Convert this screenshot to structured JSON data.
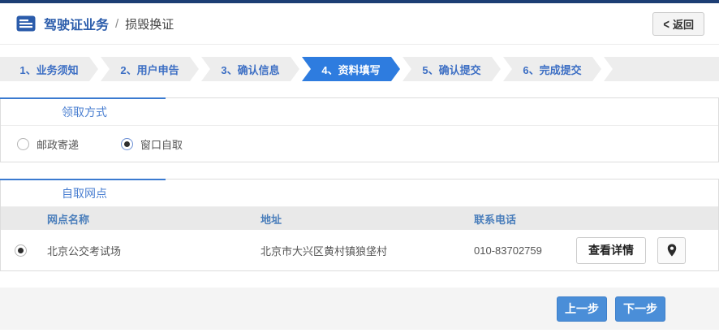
{
  "header": {
    "title": "驾驶证业务",
    "separator": "/",
    "subtitle": "损毁换证",
    "back_chevron": "<",
    "back_label": "返回"
  },
  "steps": {
    "items": [
      {
        "label": "1、业务须知",
        "active": false
      },
      {
        "label": "2、用户申告",
        "active": false
      },
      {
        "label": "3、确认信息",
        "active": false
      },
      {
        "label": "4、资料填写",
        "active": true
      },
      {
        "label": "5、确认提交",
        "active": false
      },
      {
        "label": "6、完成提交",
        "active": false
      }
    ]
  },
  "pickup": {
    "section_title": "领取方式",
    "options": [
      {
        "label": "邮政寄递",
        "selected": false
      },
      {
        "label": "窗口自取",
        "selected": true
      }
    ]
  },
  "outlets": {
    "section_title": "自取网点",
    "columns": [
      "网点名称",
      "地址",
      "联系电话"
    ],
    "rows": [
      {
        "selected": true,
        "name": "北京公交考试场",
        "address": "北京市大兴区黄村镇狼垡村",
        "phone": "010-83702759",
        "detail_label": "查看详情"
      }
    ]
  },
  "footer": {
    "prev_label": "上一步",
    "next_label": "下一步"
  },
  "colors": {
    "top_border": "#1d3e74",
    "accent_blue": "#3a7ad0",
    "active_step": "#2e7cdf",
    "link_blue": "#4a7fd1",
    "button_blue": "#4a8ed8"
  }
}
